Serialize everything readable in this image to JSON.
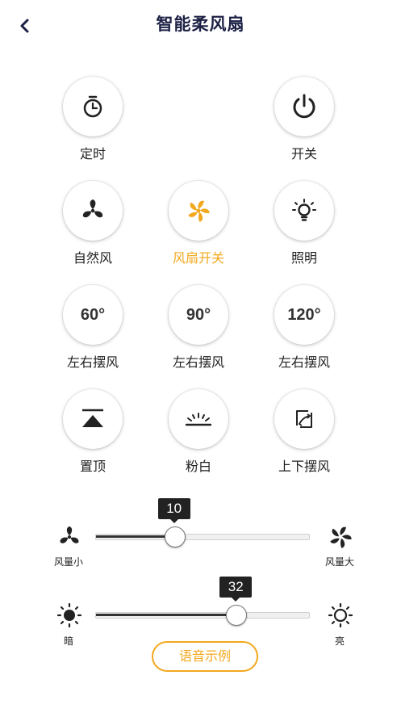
{
  "header": {
    "title": "智能柔风扇",
    "back_icon": "chevron-left-icon"
  },
  "controls": [
    {
      "label": "定时",
      "icon": "timer-icon",
      "active": false
    },
    {
      "label": "开关",
      "icon": "power-icon",
      "active": false
    },
    {
      "label": "自然风",
      "icon": "fan-icon",
      "active": false
    },
    {
      "label": "风扇开关",
      "icon": "fan-pinwheel-icon",
      "active": true
    },
    {
      "label": "照明",
      "icon": "bulb-icon",
      "active": false
    },
    {
      "label": "左右摆风",
      "icon_text": "60°",
      "active": false
    },
    {
      "label": "左右摆风",
      "icon_text": "90°",
      "active": false
    },
    {
      "label": "左右摆风",
      "icon_text": "120°",
      "active": false
    },
    {
      "label": "置顶",
      "icon": "top-icon",
      "active": false
    },
    {
      "label": "粉白",
      "icon": "sunrise-icon",
      "active": false
    },
    {
      "label": "上下摆风",
      "icon": "vertical-swing-icon",
      "active": false
    }
  ],
  "wind_slider": {
    "value": "10",
    "fraction": 0.37,
    "min_label": "风量小",
    "max_label": "风量大"
  },
  "light_slider": {
    "value": "32",
    "fraction": 0.66,
    "min_label": "暗",
    "max_label": "亮"
  },
  "voice_button": {
    "label": "语音示例"
  },
  "colors": {
    "accent": "#f2a81d",
    "title": "#1c2145",
    "text": "#222222"
  }
}
